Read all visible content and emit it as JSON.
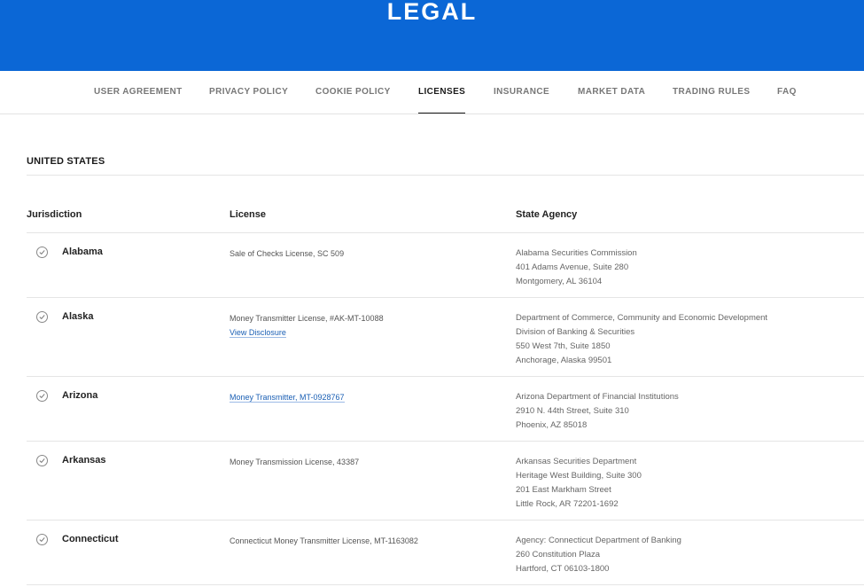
{
  "header": {
    "title": "LEGAL"
  },
  "tabs": [
    {
      "label": "USER AGREEMENT"
    },
    {
      "label": "PRIVACY POLICY"
    },
    {
      "label": "COOKIE POLICY"
    },
    {
      "label": "LICENSES"
    },
    {
      "label": "INSURANCE"
    },
    {
      "label": "MARKET DATA"
    },
    {
      "label": "TRADING RULES"
    },
    {
      "label": "FAQ"
    }
  ],
  "section": {
    "title": "UNITED STATES"
  },
  "table": {
    "headers": [
      "Jurisdiction",
      "License",
      "State Agency"
    ],
    "rows": [
      {
        "state": "Alabama",
        "license": "Sale of Checks License, SC 509",
        "agency": [
          "Alabama Securities Commission",
          "401 Adams Avenue, Suite 280",
          "Montgomery, AL 36104"
        ]
      },
      {
        "state": "Alaska",
        "license": "Money Transmitter License, #AK-MT-10088",
        "license_link": "View Disclosure",
        "agency": [
          "Department of Commerce, Community and Economic Development",
          "Division of Banking & Securities",
          "550 West 7th, Suite 1850",
          "Anchorage, Alaska 99501"
        ]
      },
      {
        "state": "Arizona",
        "license_link": "Money Transmitter, MT-0928767",
        "agency": [
          "Arizona Department of Financial Institutions",
          "2910 N. 44th Street, Suite 310",
          "Phoenix, AZ 85018"
        ]
      },
      {
        "state": "Arkansas",
        "license": "Money Transmission License, 43387",
        "agency": [
          "Arkansas Securities Department",
          "Heritage West Building, Suite 300",
          "201 East Markham Street",
          "Little Rock, AR 72201-1692"
        ]
      },
      {
        "state": "Connecticut",
        "license": "Connecticut Money Transmitter License, MT-1163082",
        "agency": [
          "Agency: Connecticut Department of Banking",
          "260 Constitution Plaza",
          "Hartford, CT 06103-1800"
        ]
      }
    ]
  },
  "colors": {
    "brand": "#0b67d6",
    "link": "#1a5fb4"
  },
  "icons": {
    "row_check": "check-circle-icon"
  }
}
